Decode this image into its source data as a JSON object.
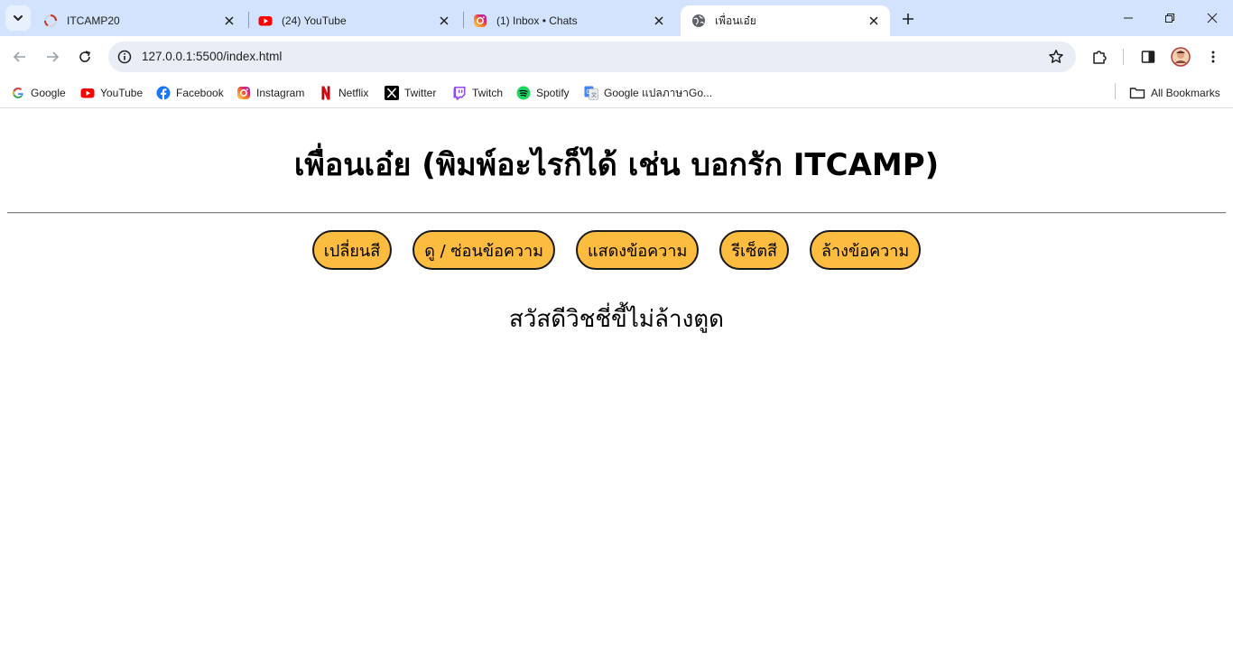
{
  "browser": {
    "tabs": [
      {
        "title": "ITCAMP20",
        "icon": "loading-icon",
        "active": false
      },
      {
        "title": "(24) YouTube",
        "icon": "youtube-icon",
        "active": false
      },
      {
        "title": "(1) Inbox • Chats",
        "icon": "instagram-icon",
        "active": false
      },
      {
        "title": "เพื่อนเอ๋ย",
        "icon": "globe-icon",
        "active": true
      }
    ],
    "url": "127.0.0.1:5500/index.html",
    "bookmarks": [
      {
        "label": "Google",
        "icon": "google-icon"
      },
      {
        "label": "YouTube",
        "icon": "youtube-icon"
      },
      {
        "label": "Facebook",
        "icon": "facebook-icon"
      },
      {
        "label": "Instagram",
        "icon": "instagram-icon"
      },
      {
        "label": "Netflix",
        "icon": "netflix-icon"
      },
      {
        "label": "Twitter",
        "icon": "x-icon"
      },
      {
        "label": "Twitch",
        "icon": "twitch-icon"
      },
      {
        "label": "Spotify",
        "icon": "spotify-icon"
      },
      {
        "label": "Google แปลภาษาGo...",
        "icon": "google-translate-icon"
      }
    ],
    "all_bookmarks_label": "All Bookmarks"
  },
  "page": {
    "title": "เพื่อนเอ๋ย (พิมพ์อะไรก็ได้ เช่น บอกรัก ITCAMP)",
    "buttons": [
      {
        "label": "เปลี่ยนสี"
      },
      {
        "label": "ดู / ซ่อนข้อความ"
      },
      {
        "label": "แสดงข้อความ"
      },
      {
        "label": "รีเซ็ตสี"
      },
      {
        "label": "ล้างข้อความ"
      }
    ],
    "message": "สวัสดีวิชชี่ขี้ไม่ล้างตูด"
  },
  "colors": {
    "tabstrip": "#d3e3fd",
    "omnibox": "#e9eef6",
    "button_fill": "#fcbc3f",
    "button_border": "#1a1a1a"
  }
}
